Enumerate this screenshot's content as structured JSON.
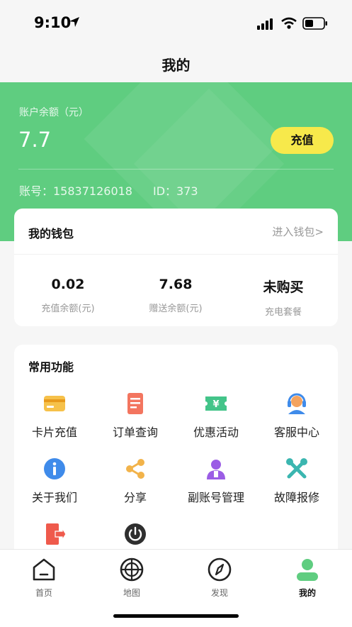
{
  "status_bar": {
    "time": "9:10"
  },
  "nav": {
    "title": "我的"
  },
  "account": {
    "balance_label": "账户余额（元）",
    "balance_value": "7.7",
    "recharge_label": "充值",
    "account_no": "账号：15837126018",
    "id": "ID：373"
  },
  "wallet": {
    "title": "我的钱包",
    "link": "进入钱包>",
    "stats": [
      {
        "value": "0.02",
        "label": "充值余额(元)"
      },
      {
        "value": "7.68",
        "label": "赠送余额(元)"
      },
      {
        "value": "未购买",
        "label": "充电套餐"
      }
    ]
  },
  "functions": {
    "title": "常用功能",
    "items": [
      {
        "label": "卡片充值",
        "icon": "card-icon"
      },
      {
        "label": "订单查询",
        "icon": "order-icon"
      },
      {
        "label": "优惠活动",
        "icon": "coupon-icon"
      },
      {
        "label": "客服中心",
        "icon": "headset-icon"
      },
      {
        "label": "关于我们",
        "icon": "info-icon"
      },
      {
        "label": "分享",
        "icon": "share-icon"
      },
      {
        "label": "副账号管理",
        "icon": "sub-account-icon"
      },
      {
        "label": "故障报修",
        "icon": "repair-icon"
      },
      {
        "label": "",
        "icon": "logout-icon"
      },
      {
        "label": "",
        "icon": "power-icon"
      }
    ]
  },
  "tabs": [
    {
      "label": "首页",
      "icon": "home-icon"
    },
    {
      "label": "地图",
      "icon": "map-radar-icon"
    },
    {
      "label": "发现",
      "icon": "compass-icon"
    },
    {
      "label": "我的",
      "icon": "profile-icon"
    }
  ],
  "colors": {
    "brand_green": "#5fcd80",
    "accent_yellow": "#f7e94b"
  }
}
